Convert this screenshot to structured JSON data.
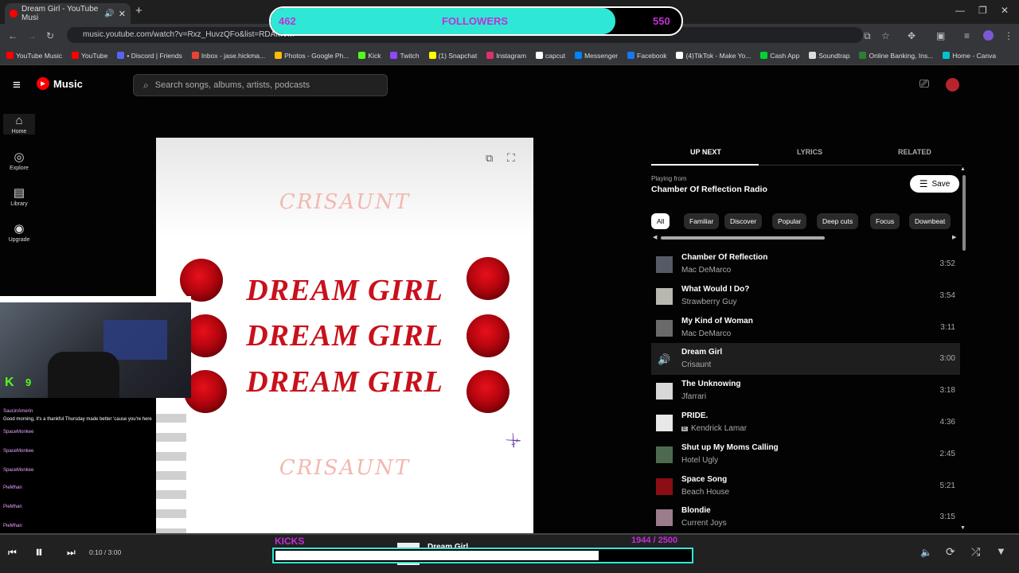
{
  "browser": {
    "tab_title": "Dream Girl - YouTube Musi",
    "new_tab": "+",
    "url": "music.youtube.com/watch?v=Rxz_HuvzQFo&list=RDAMVM",
    "bookmarks": [
      {
        "label": "YouTube Music",
        "color": "#ff0000"
      },
      {
        "label": "YouTube",
        "color": "#ff0000"
      },
      {
        "label": "• Discord | Friends",
        "color": "#5865f2"
      },
      {
        "label": "Inbox - jase.hickma...",
        "color": "#ea4335"
      },
      {
        "label": "Photos - Google Ph...",
        "color": "#fbbc04"
      },
      {
        "label": "Kick",
        "color": "#53fc18"
      },
      {
        "label": "Twitch",
        "color": "#9146ff"
      },
      {
        "label": "(1) Snapchat",
        "color": "#fffc00"
      },
      {
        "label": "Instagram",
        "color": "#e1306c"
      },
      {
        "label": "capcut",
        "color": "#ffffff"
      },
      {
        "label": "Messenger",
        "color": "#0084ff"
      },
      {
        "label": "Facebook",
        "color": "#1877f2"
      },
      {
        "label": "(4)TikTok - Make Yo...",
        "color": "#ffffff"
      },
      {
        "label": "Cash App",
        "color": "#00d632"
      },
      {
        "label": "Soundtrap",
        "color": "#dddddd"
      },
      {
        "label": "Online Banking, Ins...",
        "color": "#2e7d32"
      },
      {
        "label": "Home - Canva",
        "color": "#00c4cc"
      }
    ]
  },
  "header": {
    "logo_text": "Music",
    "search_placeholder": "Search songs, albums, artists, podcasts"
  },
  "sidebar": [
    {
      "label": "Home",
      "icon": "home-icon",
      "glyph": "⌂"
    },
    {
      "label": "Explore",
      "icon": "compass-icon",
      "glyph": "◎"
    },
    {
      "label": "Library",
      "icon": "library-icon",
      "glyph": "▤"
    },
    {
      "label": "Upgrade",
      "icon": "upgrade-icon",
      "glyph": "◉"
    }
  ],
  "art": {
    "top_text": "CRISAUNT",
    "lines": [
      "DREAM GIRL",
      "DREAM GIRL",
      "DREAM GIRL"
    ],
    "bottom_text": "CRISAUNT"
  },
  "overlay": {
    "followers_current": "462",
    "followers_label": "FOLLOWERS",
    "followers_goal": "550",
    "followers_progress": 0.84,
    "kicks_label": "KICKS",
    "kicks_count": "1944  / 2500",
    "kicks_progress": 0.78,
    "webcam_badge": "9",
    "chat": [
      {
        "name": "SaucinAmerin",
        "text": ""
      },
      {
        "name": "",
        "text": "Good morning, it's a thankful Thursday made better 'cause you're here"
      },
      {
        "name": "SpaceMonkee",
        "text": ""
      },
      {
        "name": "SpaceMonkee",
        "text": ""
      },
      {
        "name": "SpaceMonkee",
        "text": ""
      },
      {
        "name": "PieMhan",
        "text": ""
      },
      {
        "name": "PieMhan",
        "text": ""
      },
      {
        "name": "PieMhan",
        "text": ""
      }
    ]
  },
  "panel": {
    "tabs": [
      "UP NEXT",
      "LYRICS",
      "RELATED"
    ],
    "playing_from_label": "Playing from",
    "radio_name": "Chamber Of Reflection Radio",
    "save_label": "Save",
    "chips": [
      "All",
      "Familiar",
      "Discover",
      "Popular",
      "Deep cuts",
      "Focus",
      "Downbeat"
    ],
    "tracks": [
      {
        "title": "Chamber Of Reflection",
        "artist": "Mac DeMarco",
        "duration": "3:52",
        "thumb": "#555a66",
        "current": false,
        "explicit": false
      },
      {
        "title": "What Would I Do?",
        "artist": "Strawberry Guy",
        "duration": "3:54",
        "thumb": "#b8b8b0",
        "current": false,
        "explicit": false
      },
      {
        "title": "My Kind of Woman",
        "artist": "Mac DeMarco",
        "duration": "3:11",
        "thumb": "#6a6a6a",
        "current": false,
        "explicit": false
      },
      {
        "title": "Dream Girl",
        "artist": "Crisaunt",
        "duration": "3:00",
        "thumb": "#1e1e1e",
        "current": true,
        "explicit": false
      },
      {
        "title": "The Unknowing",
        "artist": "Jfarrari",
        "duration": "3:18",
        "thumb": "#d8d8d8",
        "current": false,
        "explicit": false
      },
      {
        "title": "PRIDE.",
        "artist": "Kendrick Lamar",
        "duration": "4:36",
        "thumb": "#e8e8e8",
        "current": false,
        "explicit": true
      },
      {
        "title": "Shut up My Moms Calling",
        "artist": "Hotel Ugly",
        "duration": "2:45",
        "thumb": "#4d6a50",
        "current": false,
        "explicit": false
      },
      {
        "title": "Space Song",
        "artist": "Beach House",
        "duration": "5:21",
        "thumb": "#8a0e14",
        "current": false,
        "explicit": false
      },
      {
        "title": "Blondie",
        "artist": "Current Joys",
        "duration": "3:15",
        "thumb": "#9a7c8c",
        "current": false,
        "explicit": false
      }
    ]
  },
  "player": {
    "time": "0:10 / 3:00",
    "now_playing_title": "Dream Girl"
  }
}
